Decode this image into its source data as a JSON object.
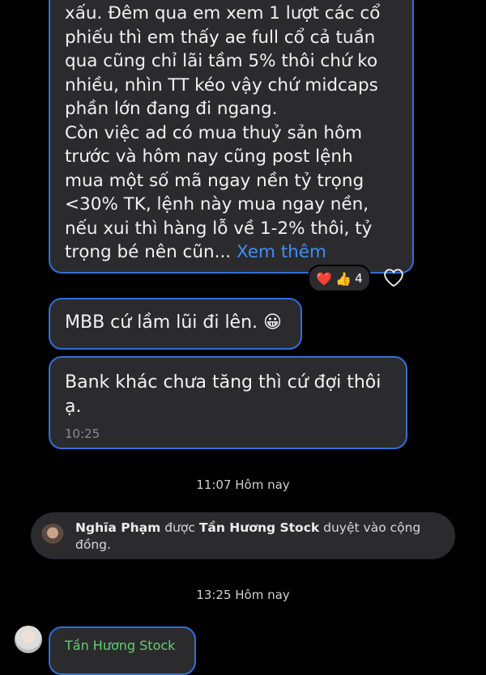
{
  "message1": {
    "lines": [
      "xấu. Đêm qua em xem 1 lượt các cổ",
      "phiếu thì em thấy ae full cổ cả tuần",
      "qua cũng chỉ lãi tầm 5% thôi chứ ko",
      "nhiều, nhìn TT kéo vậy chứ midcaps",
      "phần lớn đang đi ngang.",
      "Còn việc ad có mua thuỷ sản hôm",
      "trước và hôm nay cũng post lệnh",
      "mua một số mã ngay nền  tỷ trọng",
      "<30% TK, lệnh này mua ngay nền,",
      "nếu xui thì hàng lỗ về 1-2% thôi, tỷ"
    ],
    "last_line": "trọng bé nên cũn...",
    "see_more": "Xem thêm",
    "reaction_count": "4"
  },
  "message2": {
    "text": "MBB cứ lầm lũi đi lên.",
    "emoji": "😀"
  },
  "message3": {
    "text": "Bank khác chưa tăng thì cứ đợi thôi ạ.",
    "time": "10:25"
  },
  "timestamp1": "11:07 Hôm nay",
  "system_notice": {
    "user": "Nghĩa Phạm",
    "verb": "được",
    "admin": "Tần Hương Stock",
    "rest": "duyệt vào cộng đồng."
  },
  "timestamp2": "13:25 Hôm nay",
  "message4": {
    "sender": "Tần Hương Stock"
  }
}
